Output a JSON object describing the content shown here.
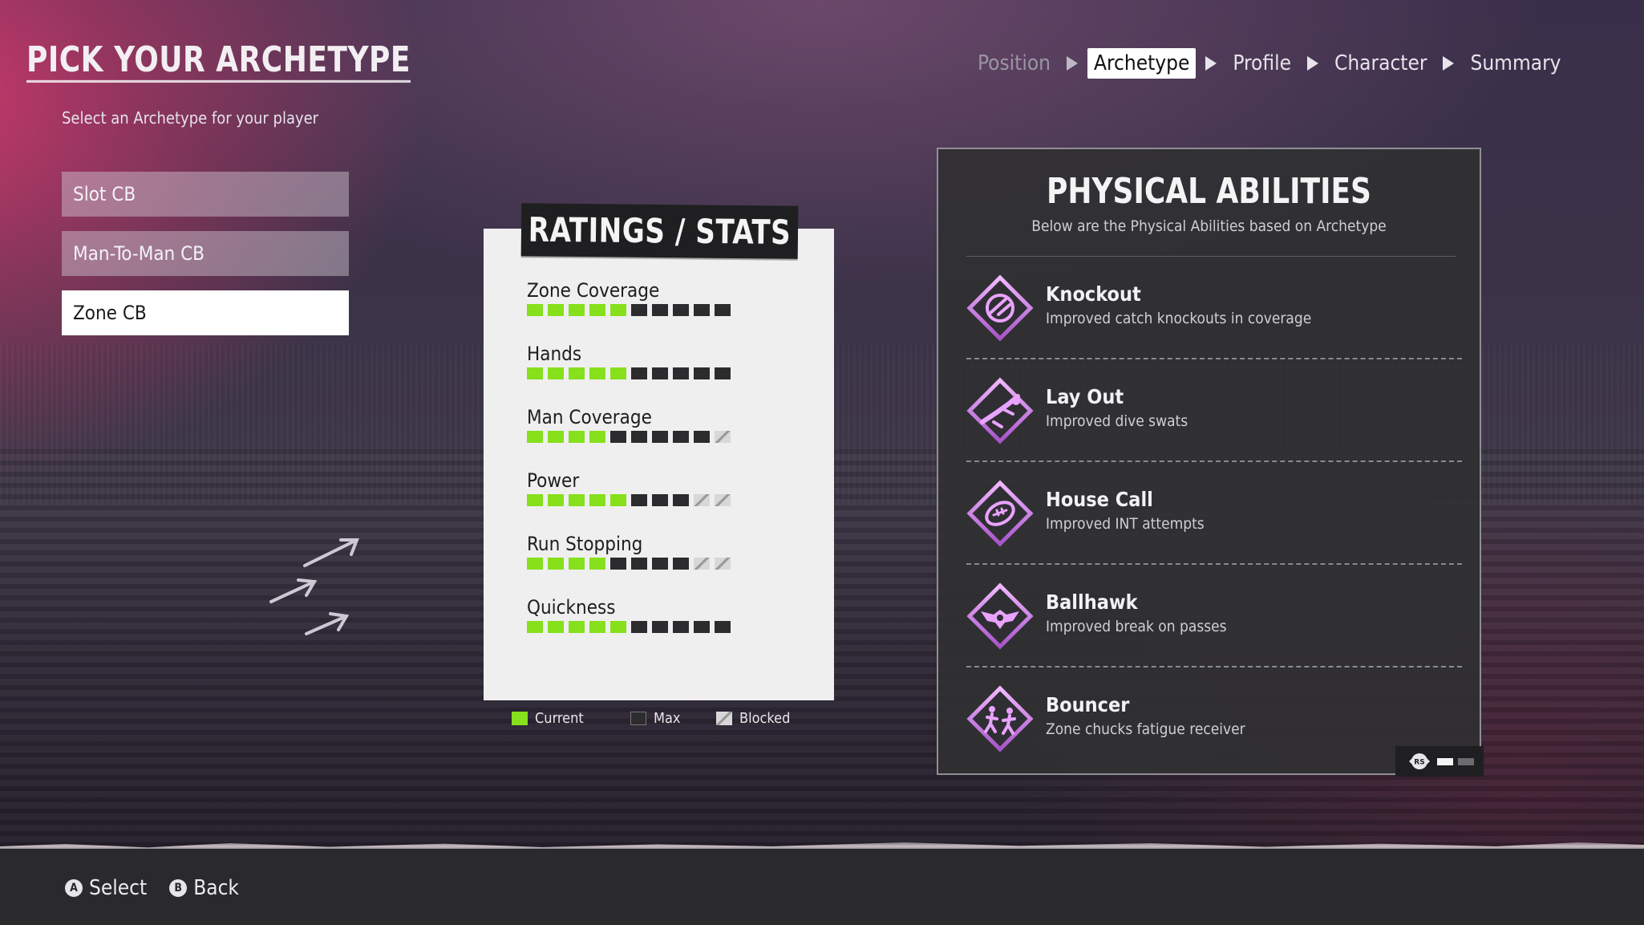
{
  "header": {
    "title": "PICK YOUR ARCHETYPE",
    "subtitle": "Select an Archetype for your player"
  },
  "breadcrumbs": [
    {
      "label": "Position",
      "state": "done"
    },
    {
      "label": "Archetype",
      "state": "active"
    },
    {
      "label": "Profile",
      "state": "upcoming"
    },
    {
      "label": "Character",
      "state": "upcoming"
    },
    {
      "label": "Summary",
      "state": "upcoming"
    }
  ],
  "archetypes": {
    "items": [
      "Slot CB",
      "Man-To-Man CB",
      "Zone CB"
    ],
    "selected": "Zone CB"
  },
  "ratings": {
    "title": "RATINGS / STATS",
    "stats": [
      {
        "name": "Zone Coverage",
        "current": 5,
        "max": 5,
        "blocked": 0
      },
      {
        "name": "Hands",
        "current": 5,
        "max": 5,
        "blocked": 0
      },
      {
        "name": "Man Coverage",
        "current": 4,
        "max": 5,
        "blocked": 1
      },
      {
        "name": "Power",
        "current": 5,
        "max": 3,
        "blocked": 2
      },
      {
        "name": "Run Stopping",
        "current": 4,
        "max": 4,
        "blocked": 2
      },
      {
        "name": "Quickness",
        "current": 5,
        "max": 5,
        "blocked": 0
      }
    ],
    "legend": {
      "current": "Current",
      "max": "Max",
      "blocked": "Blocked"
    }
  },
  "physical_abilities": {
    "title": "PHYSICAL ABILITIES",
    "subtitle": "Below are the Physical Abilities based on Archetype",
    "items": [
      {
        "name": "Knockout",
        "description": "Improved catch knockouts in coverage",
        "icon": "knockout-icon"
      },
      {
        "name": "Lay Out",
        "description": "Improved dive swats",
        "icon": "lay-out-icon"
      },
      {
        "name": "House Call",
        "description": "Improved INT attempts",
        "icon": "house-call-icon"
      },
      {
        "name": "Ballhawk",
        "description": "Improved break on passes",
        "icon": "ballhawk-icon"
      },
      {
        "name": "Bouncer",
        "description": "Zone chucks fatigue receiver",
        "icon": "bouncer-icon"
      }
    ],
    "page_indicator": {
      "label": "RS",
      "pages": 2,
      "current_page": 1
    }
  },
  "footer": {
    "hints": [
      {
        "button": "A",
        "label": "Select"
      },
      {
        "button": "B",
        "label": "Back"
      }
    ]
  },
  "colors": {
    "current": "#86e01c",
    "max": "#2c2c2e",
    "ability_icon": "#d98cf0"
  }
}
